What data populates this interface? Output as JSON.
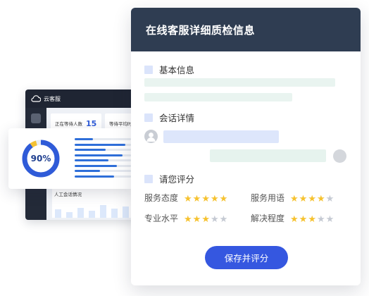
{
  "dashboard": {
    "app_name": "云客服",
    "stats": [
      {
        "label": "正在等待人数",
        "value": "15"
      },
      {
        "label": "等待平均时"
      }
    ],
    "chart_caption": "人工会话情况"
  },
  "gauge": {
    "percent_label": "90%",
    "value": 0.9,
    "bars": [
      0.32,
      0.9,
      0.55,
      0.85,
      0.6,
      0.75,
      0.45,
      0.7
    ]
  },
  "card": {
    "title": "在线客服详细质检信息",
    "sections": {
      "basic": "基本信息",
      "session": "会话详情",
      "rating": "请您评分"
    },
    "ratings": [
      {
        "label": "服务态度",
        "stars": 5,
        "max": 5
      },
      {
        "label": "服务用语",
        "stars": 4,
        "max": 5
      },
      {
        "label": "专业水平",
        "stars": 3,
        "max": 5
      },
      {
        "label": "解决程度",
        "stars": 3,
        "max": 5
      }
    ],
    "submit_label": "保存并评分"
  },
  "colors": {
    "header": "#2f3d52",
    "accent": "#3557e0",
    "star_on": "#f6c22f",
    "star_off": "#c5cad3"
  }
}
